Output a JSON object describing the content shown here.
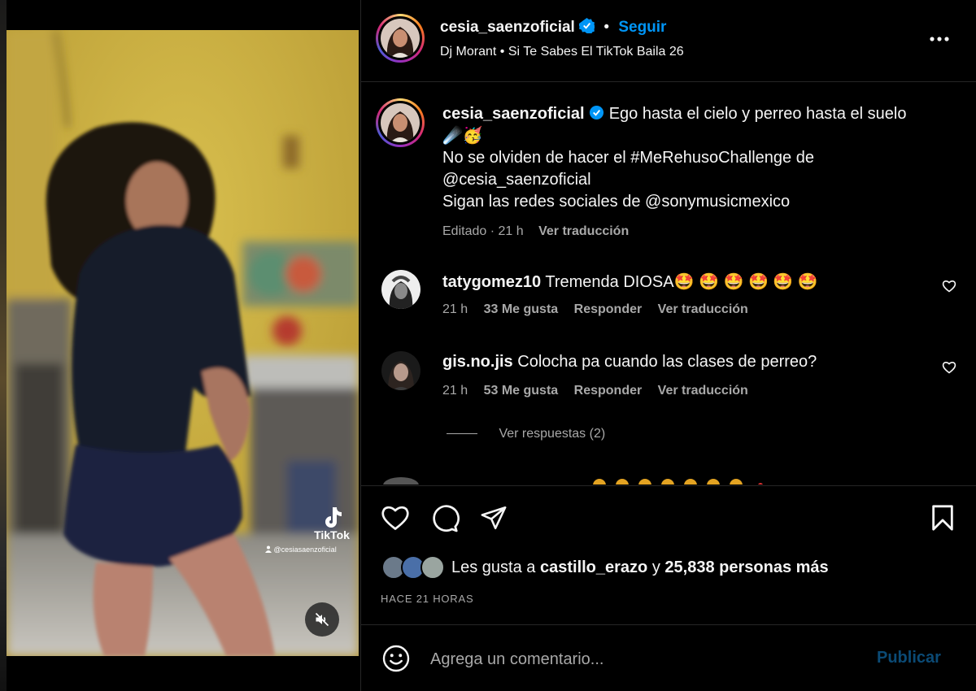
{
  "header": {
    "username": "cesia_saenzoficial",
    "separator": "•",
    "follow_label": "Seguir",
    "audio": "Dj Morant • Si Te Sabes El TikTok Baila 26"
  },
  "media": {
    "watermark_brand": "TikTok",
    "watermark_handle": "@cesiasaenzoficial",
    "mute_icon": "speaker-muted-icon"
  },
  "caption": {
    "username": "cesia_saenzoficial",
    "line1": "Ego hasta el cielo y perreo hasta el suelo",
    "emojis": "☄️🥳",
    "line2": "No se olviden de hacer el #MeRehusoChallenge de",
    "line3": "@cesia_saenzoficial",
    "line4": "Sigan las redes sociales de @sonymusicmexico",
    "meta": "Editado · 21 h",
    "translate_label": "Ver traducción"
  },
  "comments": [
    {
      "username": "tatygomez10",
      "text": "Tremenda DIOSA🤩 🤩 🤩 🤩 🤩 🤩",
      "time": "21 h",
      "likes": "33 Me gusta",
      "reply_label": "Responder",
      "translate_label": "Ver traducción"
    },
    {
      "username": "gis.no.jis",
      "text": "Colocha pa cuando las clases de perreo?",
      "time": "21 h",
      "likes": "53 Me gusta",
      "reply_label": "Responder",
      "translate_label": "Ver traducción"
    }
  ],
  "view_replies_label": "Ver respuestas (2)",
  "likes": {
    "prefix": "Les gusta a",
    "first_user": "castillo_erazo",
    "joiner": "y",
    "others": "25,838 personas más"
  },
  "timestamp": "HACE 21 HORAS",
  "comment_box": {
    "placeholder": "Agrega un comentario...",
    "publish_label": "Publicar"
  },
  "colors": {
    "accent": "#0095f6",
    "publish_disabled": "#0b4a75",
    "muted_text": "#a8a8a8",
    "divider": "#262626"
  }
}
